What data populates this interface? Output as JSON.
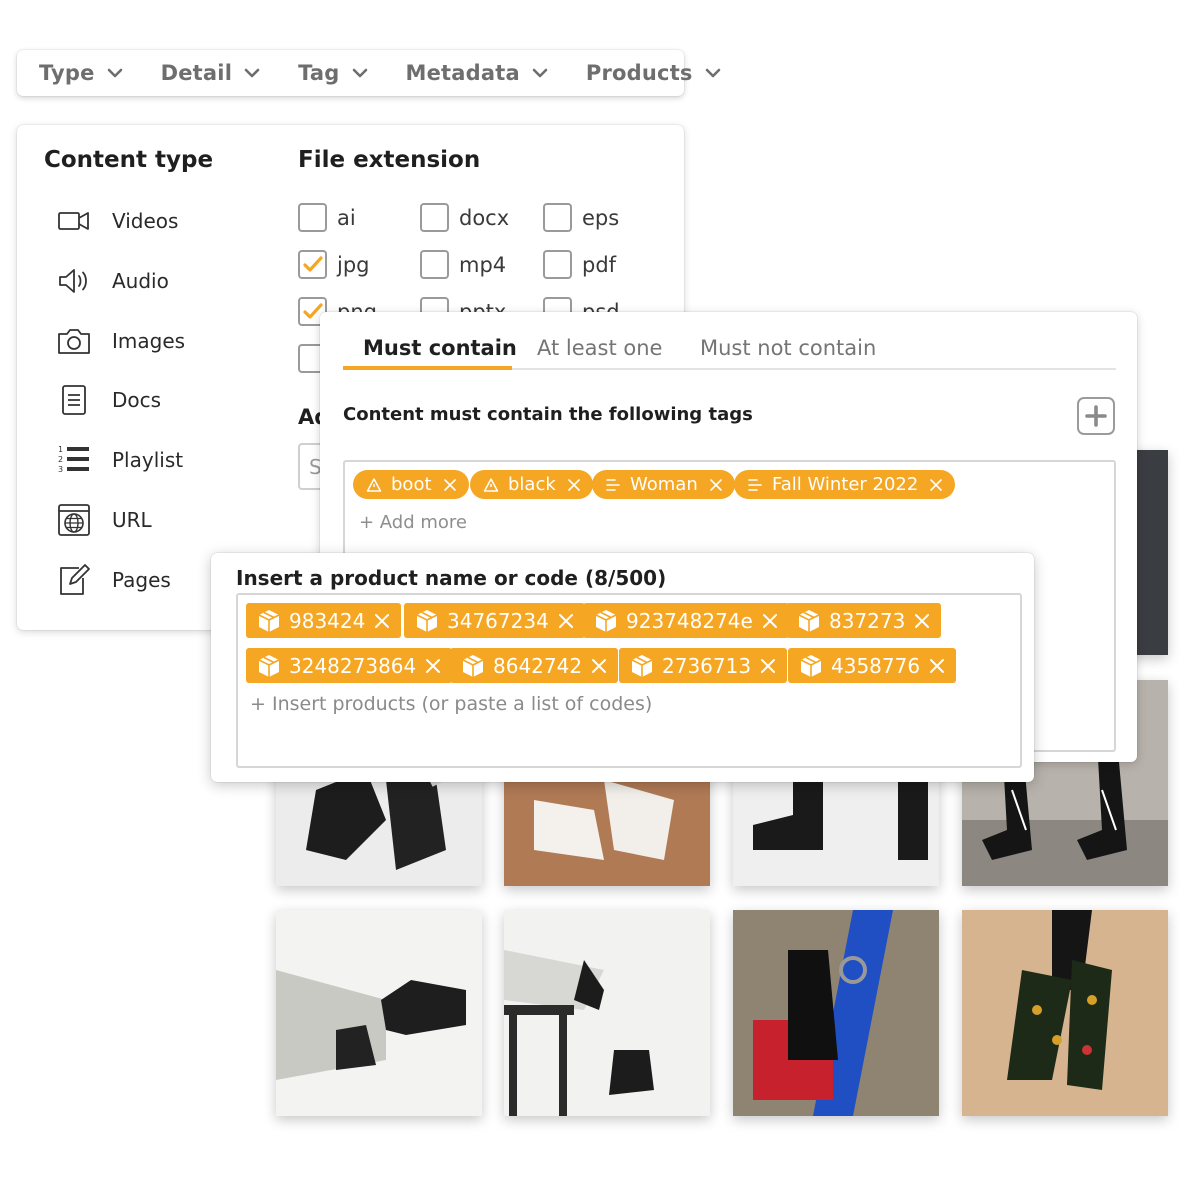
{
  "filter_bar": {
    "items": [
      "Type",
      "Detail",
      "Tag",
      "Metadata",
      "Products"
    ]
  },
  "content_type": {
    "title": "Content type",
    "items": [
      {
        "label": "Videos",
        "icon": "video-icon"
      },
      {
        "label": "Audio",
        "icon": "speaker-icon"
      },
      {
        "label": "Images",
        "icon": "camera-icon"
      },
      {
        "label": "Docs",
        "icon": "document-icon"
      },
      {
        "label": "Playlist",
        "icon": "numbered-list-icon"
      },
      {
        "label": "URL",
        "icon": "globe-icon"
      },
      {
        "label": "Pages",
        "icon": "edit-page-icon"
      }
    ]
  },
  "file_extension": {
    "title": "File extension",
    "options": [
      {
        "label": "ai",
        "checked": false
      },
      {
        "label": "docx",
        "checked": false
      },
      {
        "label": "eps",
        "checked": false
      },
      {
        "label": "jpg",
        "checked": true
      },
      {
        "label": "mp4",
        "checked": false
      },
      {
        "label": "pdf",
        "checked": false
      },
      {
        "label": "png",
        "checked": true
      },
      {
        "label": "pptx",
        "checked": false
      },
      {
        "label": "psd",
        "checked": false
      }
    ],
    "partial_label": "Ad",
    "partial_input": "S"
  },
  "tags_panel": {
    "tabs": [
      "Must contain",
      "At least one",
      "Must not contain"
    ],
    "active_tab": "Must contain",
    "description": "Content must contain the following tags",
    "tags": [
      {
        "label": "boot",
        "icon": "warning-icon"
      },
      {
        "label": "black",
        "icon": "warning-icon"
      },
      {
        "label": "Woman",
        "icon": "list-lines-icon"
      },
      {
        "label": "Fall Winter 2022",
        "icon": "list-lines-icon"
      }
    ],
    "add_more": "+ Add more"
  },
  "products_panel": {
    "title": "Insert a product name or code (8/500)",
    "products": [
      "983424",
      "34767234",
      "923748274e",
      "837273",
      "3248273864",
      "8642742",
      "2736713",
      "4358776"
    ],
    "input_placeholder": "+ Insert products (or paste a list of codes)"
  },
  "colors": {
    "accent": "#f5a623",
    "text": "#1f1f1f",
    "muted": "#757575"
  }
}
